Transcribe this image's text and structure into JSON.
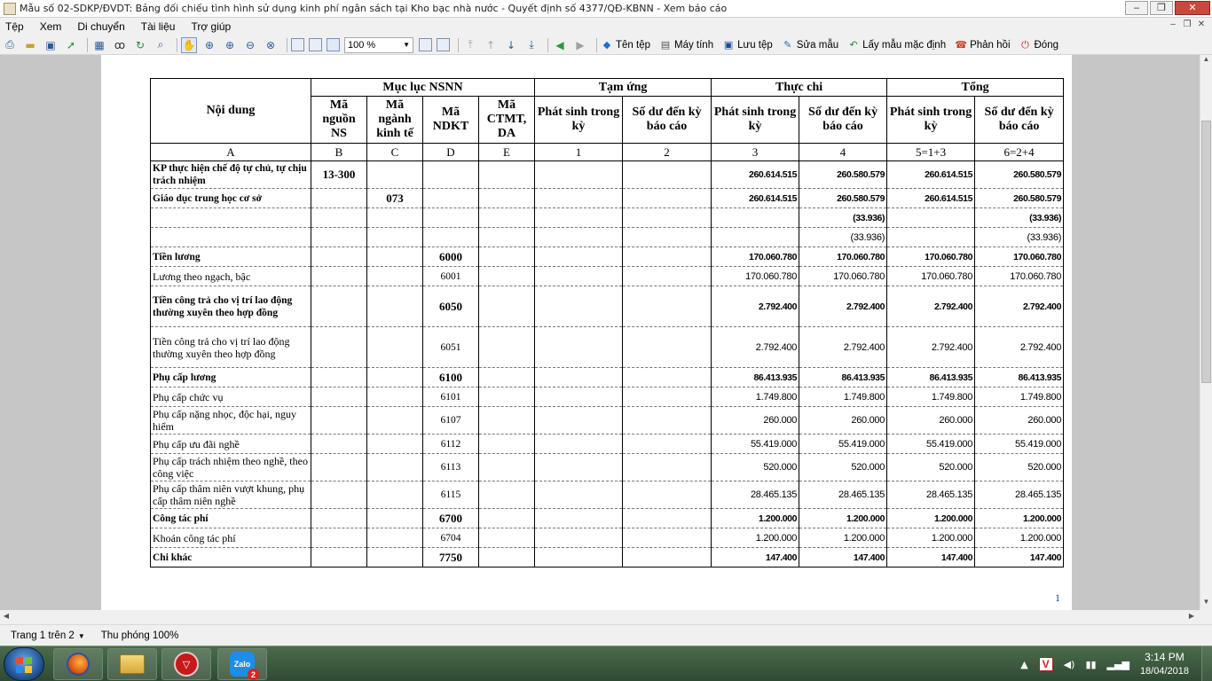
{
  "window": {
    "title": "Mẫu số 02-SDKP/ĐVDT: Bảng đối chiếu tình hình sử dụng kinh phí ngân sách tại Kho bạc nhà nước - Quyết định số 4377/QĐ-KBNN - Xem báo cáo"
  },
  "menu": [
    "Tệp",
    "Xem",
    "Di chuyển",
    "Tài liệu",
    "Trợ giúp"
  ],
  "toolbar": {
    "zoom": "100 %",
    "buttons": [
      "Tên tệp",
      "Máy tính",
      "Lưu tệp",
      "Sửa mẫu",
      "Lấy mẫu mặc định",
      "Phản hồi",
      "Đóng"
    ]
  },
  "report": {
    "headers": {
      "noi_dung": "Nội dung",
      "muc_luc": "Mục lục NSNN",
      "tam_ung": "Tạm ứng",
      "thuc_chi": "Thực chi",
      "tong": "Tổng",
      "ma_nguon": "Mã nguồn NS",
      "ma_nganh": "Mã ngành kinh tế",
      "ma_ndkt": "Mã NDKT",
      "ma_ctmt": "Mã CTMT, DA",
      "phat_sinh": "Phát sinh trong kỳ",
      "so_du": "Số dư đến kỳ báo cáo"
    },
    "letters": [
      "A",
      "B",
      "C",
      "D",
      "E",
      "1",
      "2",
      "3",
      "4",
      "5=1+3",
      "6=2+4"
    ],
    "rows": [
      {
        "bold": true,
        "text": "KP thực hiện chế độ tự chủ, tự chịu trách nhiệm",
        "nguon": "13-300",
        "nganh": "",
        "ndkt": "",
        "ctmt": "",
        "ps_tu": "",
        "sd_tu": "",
        "ps_tc": "260.614.515",
        "sd_tc": "260.580.579",
        "ps_t": "260.614.515",
        "sd_t": "260.580.579"
      },
      {
        "bold": true,
        "text": "Giáo dục trung học cơ sở",
        "nguon": "",
        "nganh": "073",
        "ndkt": "",
        "ctmt": "",
        "ps_tu": "",
        "sd_tu": "",
        "ps_tc": "260.614.515",
        "sd_tc": "260.580.579",
        "ps_t": "260.614.515",
        "sd_t": "260.580.579"
      },
      {
        "bold": true,
        "text": "",
        "nguon": "",
        "nganh": "",
        "ndkt": "",
        "ctmt": "",
        "ps_tu": "",
        "sd_tu": "",
        "ps_tc": "",
        "sd_tc": "(33.936)",
        "ps_t": "",
        "sd_t": "(33.936)"
      },
      {
        "bold": false,
        "text": "",
        "nguon": "",
        "nganh": "",
        "ndkt": "",
        "ctmt": "",
        "ps_tu": "",
        "sd_tu": "",
        "ps_tc": "",
        "sd_tc": "(33.936)",
        "ps_t": "",
        "sd_t": "(33.936)"
      },
      {
        "bold": true,
        "text": "Tiền lương",
        "nguon": "",
        "nganh": "",
        "ndkt": "6000",
        "ctmt": "",
        "ps_tu": "",
        "sd_tu": "",
        "ps_tc": "170.060.780",
        "sd_tc": "170.060.780",
        "ps_t": "170.060.780",
        "sd_t": "170.060.780"
      },
      {
        "bold": false,
        "text": "Lương theo ngạch, bậc",
        "nguon": "",
        "nganh": "",
        "ndkt": "6001",
        "ctmt": "",
        "ps_tu": "",
        "sd_tu": "",
        "ps_tc": "170.060.780",
        "sd_tc": "170.060.780",
        "ps_t": "170.060.780",
        "sd_t": "170.060.780"
      },
      {
        "bold": true,
        "text": "Tiền công trả cho vị trí lao động thường xuyên theo hợp đồng",
        "nguon": "",
        "nganh": "",
        "ndkt": "6050",
        "ctmt": "",
        "ps_tu": "",
        "sd_tu": "",
        "ps_tc": "2.792.400",
        "sd_tc": "2.792.400",
        "ps_t": "2.792.400",
        "sd_t": "2.792.400"
      },
      {
        "bold": false,
        "text": "Tiền công trả cho vị trí lao động thường xuyên theo hợp đồng",
        "nguon": "",
        "nganh": "",
        "ndkt": "6051",
        "ctmt": "",
        "ps_tu": "",
        "sd_tu": "",
        "ps_tc": "2.792.400",
        "sd_tc": "2.792.400",
        "ps_t": "2.792.400",
        "sd_t": "2.792.400"
      },
      {
        "bold": true,
        "text": "Phụ cấp lương",
        "nguon": "",
        "nganh": "",
        "ndkt": "6100",
        "ctmt": "",
        "ps_tu": "",
        "sd_tu": "",
        "ps_tc": "86.413.935",
        "sd_tc": "86.413.935",
        "ps_t": "86.413.935",
        "sd_t": "86.413.935"
      },
      {
        "bold": false,
        "text": "Phụ cấp chức vụ",
        "nguon": "",
        "nganh": "",
        "ndkt": "6101",
        "ctmt": "",
        "ps_tu": "",
        "sd_tu": "",
        "ps_tc": "1.749.800",
        "sd_tc": "1.749.800",
        "ps_t": "1.749.800",
        "sd_t": "1.749.800"
      },
      {
        "bold": false,
        "text": "Phụ cấp nặng nhọc, độc hại, nguy hiểm",
        "nguon": "",
        "nganh": "",
        "ndkt": "6107",
        "ctmt": "",
        "ps_tu": "",
        "sd_tu": "",
        "ps_tc": "260.000",
        "sd_tc": "260.000",
        "ps_t": "260.000",
        "sd_t": "260.000"
      },
      {
        "bold": false,
        "text": "Phụ cấp ưu đãi nghề",
        "nguon": "",
        "nganh": "",
        "ndkt": "6112",
        "ctmt": "",
        "ps_tu": "",
        "sd_tu": "",
        "ps_tc": "55.419.000",
        "sd_tc": "55.419.000",
        "ps_t": "55.419.000",
        "sd_t": "55.419.000"
      },
      {
        "bold": false,
        "text": "Phụ cấp trách nhiệm theo nghề, theo công việc",
        "nguon": "",
        "nganh": "",
        "ndkt": "6113",
        "ctmt": "",
        "ps_tu": "",
        "sd_tu": "",
        "ps_tc": "520.000",
        "sd_tc": "520.000",
        "ps_t": "520.000",
        "sd_t": "520.000"
      },
      {
        "bold": false,
        "text": "Phụ cấp thâm niên vượt khung, phụ cấp thâm niên nghề",
        "nguon": "",
        "nganh": "",
        "ndkt": "6115",
        "ctmt": "",
        "ps_tu": "",
        "sd_tu": "",
        "ps_tc": "28.465.135",
        "sd_tc": "28.465.135",
        "ps_t": "28.465.135",
        "sd_t": "28.465.135"
      },
      {
        "bold": true,
        "text": "Công tác phí",
        "nguon": "",
        "nganh": "",
        "ndkt": "6700",
        "ctmt": "",
        "ps_tu": "",
        "sd_tu": "",
        "ps_tc": "1.200.000",
        "sd_tc": "1.200.000",
        "ps_t": "1.200.000",
        "sd_t": "1.200.000"
      },
      {
        "bold": false,
        "text": "Khoán công tác phí",
        "nguon": "",
        "nganh": "",
        "ndkt": "6704",
        "ctmt": "",
        "ps_tu": "",
        "sd_tu": "",
        "ps_tc": "1.200.000",
        "sd_tc": "1.200.000",
        "ps_t": "1.200.000",
        "sd_t": "1.200.000"
      },
      {
        "bold": true,
        "text": "Chi khác",
        "nguon": "",
        "nganh": "",
        "ndkt": "7750",
        "ctmt": "",
        "ps_tu": "",
        "sd_tu": "",
        "ps_tc": "147.400",
        "sd_tc": "147.400",
        "ps_t": "147.400",
        "sd_t": "147.400"
      }
    ],
    "page_number": "1"
  },
  "status": {
    "page": "Trang 1 trên 2",
    "zoom": "Thu phóng 100%"
  },
  "taskbar": {
    "zalo_badge": "2",
    "time": "3:14 PM",
    "date": "18/04/2018"
  }
}
